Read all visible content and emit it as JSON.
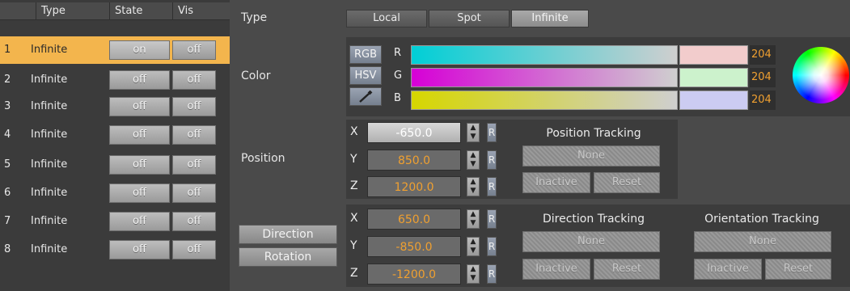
{
  "table": {
    "headers": [
      "Type",
      "State",
      "Vis"
    ],
    "rows": [
      {
        "num": "1",
        "type": "Infinite",
        "state": "on",
        "vis": "off"
      },
      {
        "num": "2",
        "type": "Infinite",
        "state": "off",
        "vis": "off"
      },
      {
        "num": "3",
        "type": "Infinite",
        "state": "off",
        "vis": "off"
      },
      {
        "num": "4",
        "type": "Infinite",
        "state": "off",
        "vis": "off"
      },
      {
        "num": "5",
        "type": "Infinite",
        "state": "off",
        "vis": "off"
      },
      {
        "num": "6",
        "type": "Infinite",
        "state": "off",
        "vis": "off"
      },
      {
        "num": "7",
        "type": "Infinite",
        "state": "off",
        "vis": "off"
      },
      {
        "num": "8",
        "type": "Infinite",
        "state": "off",
        "vis": "off"
      }
    ],
    "selected_row": 1
  },
  "type_section": {
    "label": "Type",
    "options": [
      "Local",
      "Spot",
      "Infinite"
    ],
    "active": "Infinite"
  },
  "color": {
    "label": "Color",
    "mode_buttons": {
      "rgb": "RGB",
      "hsv": "HSV"
    },
    "picker_icon": "eyedropper-icon",
    "channels": [
      {
        "name": "R",
        "value": "204"
      },
      {
        "name": "G",
        "value": "204"
      },
      {
        "name": "B",
        "value": "204"
      }
    ],
    "bar_colors": {
      "r": "#00cfd6",
      "g": "#d600d6",
      "b": "#d6d600"
    },
    "swatch_colors": {
      "r": "#f2cccc",
      "g": "#ccf2cc",
      "b": "#ccccf2"
    },
    "value_color": "#f0a030"
  },
  "position": {
    "label": "Position",
    "x": "-650.0",
    "y": "850.0",
    "z": "1200.0",
    "axis_labels": {
      "x": "X",
      "y": "Y",
      "z": "Z"
    },
    "reset_label": "R",
    "tracking": {
      "title": "Position Tracking",
      "target": "None",
      "inactive": "Inactive",
      "reset": "Reset"
    }
  },
  "direction": {
    "x": "650.0",
    "y": "-850.0",
    "z": "-1200.0",
    "reset_label": "R",
    "direction_button": "Direction",
    "rotation_button": "Rotation",
    "direction_tracking": {
      "title": "Direction Tracking",
      "target": "None",
      "inactive": "Inactive",
      "reset": "Reset"
    },
    "orientation_tracking": {
      "title": "Orientation Tracking",
      "target": "None",
      "inactive": "Inactive",
      "reset": "Reset"
    }
  }
}
